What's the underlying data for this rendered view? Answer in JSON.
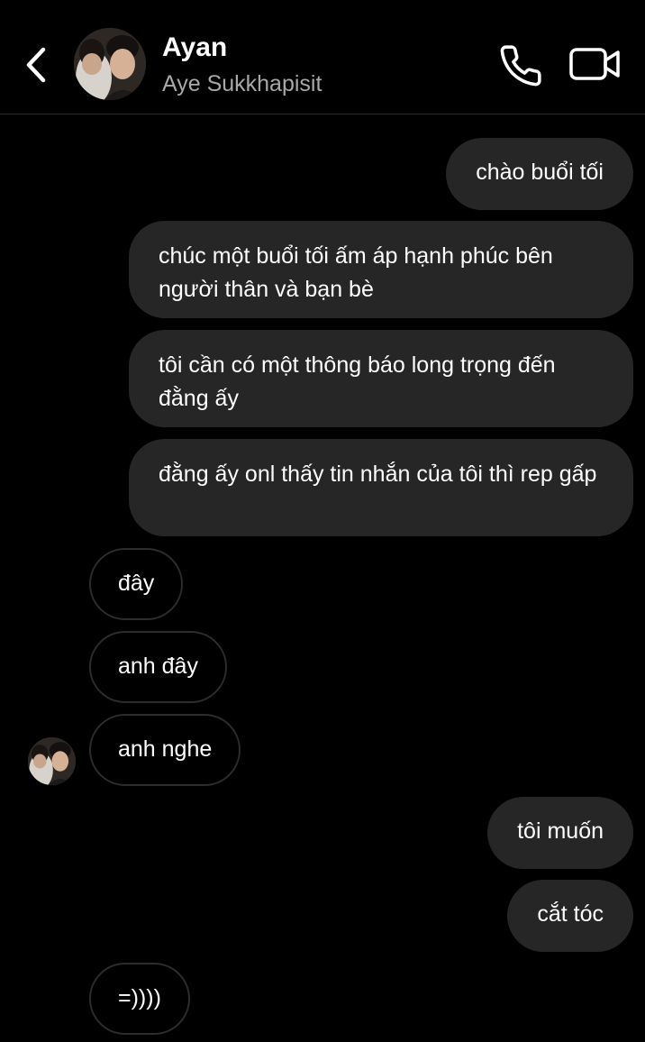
{
  "header": {
    "name": "Ayan",
    "username": "Aye Sukkhapisit",
    "back_icon": "chevron-left-icon",
    "call_icon": "phone-icon",
    "video_icon": "video-camera-icon"
  },
  "messages": [
    {
      "from": "me",
      "text": "chào buổi tối"
    },
    {
      "from": "me",
      "text": "chúc một buổi tối ấm áp hạnh phúc bên người thân và bạn bè"
    },
    {
      "from": "me",
      "text": "tôi cần có một thông báo long trọng đến đằng ấy"
    },
    {
      "from": "me",
      "text": "đằng ấy onl thấy tin nhắn của tôi thì rep gấp"
    },
    {
      "from": "them",
      "text": "đây"
    },
    {
      "from": "them",
      "text": "anh đây"
    },
    {
      "from": "them",
      "text": "anh nghe"
    },
    {
      "from": "me",
      "text": "tôi muốn"
    },
    {
      "from": "me",
      "text": "cắt tóc"
    },
    {
      "from": "them",
      "text": "=))))"
    }
  ],
  "colors": {
    "background": "#000000",
    "sent_bubble": "#262626",
    "received_border": "#2c2c2c",
    "secondary_text": "#a8a8a8"
  }
}
